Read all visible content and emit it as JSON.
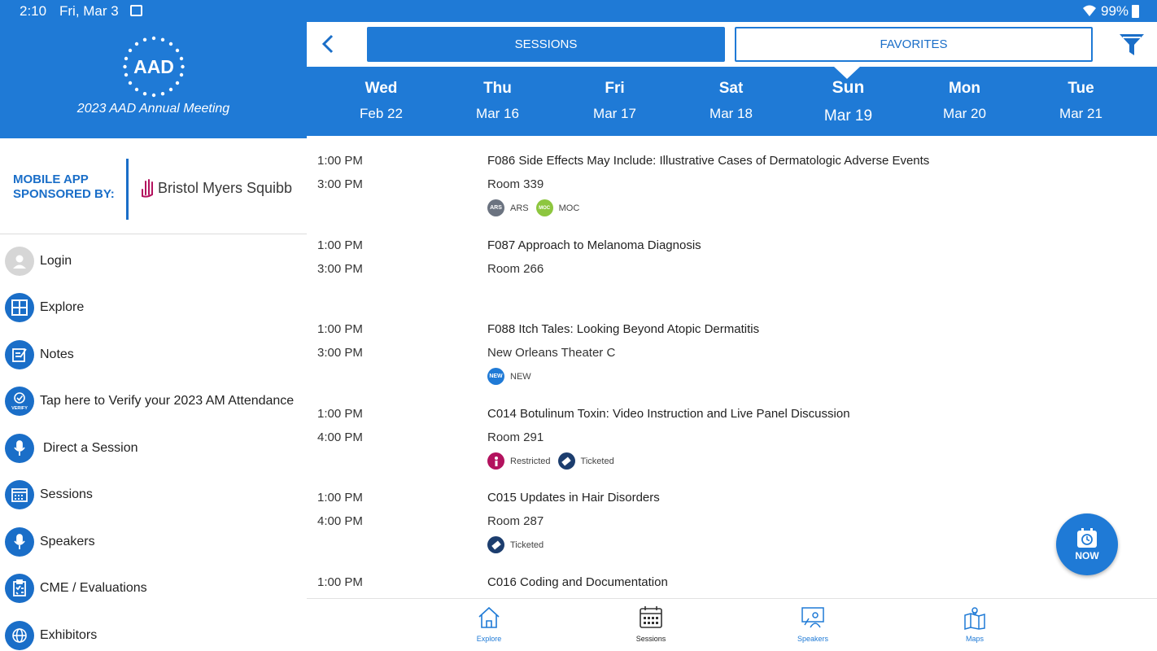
{
  "status_bar": {
    "time": "2:10",
    "date": "Fri, Mar 3",
    "battery": "99%"
  },
  "sidebar": {
    "logo_text": "AAD",
    "meeting_title": "2023 AAD Annual Meeting",
    "sponsor_label": "MOBILE APP SPONSORED BY:",
    "sponsor_name": "Bristol Myers Squibb",
    "menu": [
      {
        "label": "Login",
        "icon": "user-icon"
      },
      {
        "label": "Explore",
        "icon": "grid-icon"
      },
      {
        "label": "Notes",
        "icon": "notes-icon"
      },
      {
        "label": "Tap here to Verify your 2023 AM Attendance",
        "icon": "verify-icon",
        "icon_text": "VERIFY"
      },
      {
        "label": "Direct a Session",
        "icon": "microphone-icon"
      },
      {
        "label": "Sessions",
        "icon": "calendar-icon"
      },
      {
        "label": "Speakers",
        "icon": "microphone-icon"
      },
      {
        "label": "CME / Evaluations",
        "icon": "clipboard-icon"
      },
      {
        "label": "Exhibitors",
        "icon": "globe-icon"
      }
    ]
  },
  "toolbar": {
    "sessions_label": "SESSIONS",
    "favorites_label": "FAVORITES"
  },
  "days": [
    {
      "name": "Wed",
      "date": "Feb 22"
    },
    {
      "name": "Thu",
      "date": "Mar 16"
    },
    {
      "name": "Fri",
      "date": "Mar 17"
    },
    {
      "name": "Sat",
      "date": "Mar 18"
    },
    {
      "name": "Sun",
      "date": "Mar 19",
      "selected": true
    },
    {
      "name": "Mon",
      "date": "Mar 20"
    },
    {
      "name": "Tue",
      "date": "Mar 21"
    }
  ],
  "sessions": [
    {
      "start": "1:00 PM",
      "end": "3:00 PM",
      "title": "F086 Side Effects May Include: Illustrative Cases of Dermatologic Adverse Events",
      "room": "Room 339",
      "badges": [
        {
          "label": "ARS",
          "icon_text": "ARS",
          "color": "#6b7380"
        },
        {
          "label": "MOC",
          "icon_text": "MOC",
          "color": "#8dc63f"
        }
      ]
    },
    {
      "start": "1:00 PM",
      "end": "3:00 PM",
      "title": "F087 Approach to Melanoma Diagnosis",
      "room": "Room 266",
      "badges": []
    },
    {
      "start": "1:00 PM",
      "end": "3:00 PM",
      "title": "F088 Itch Tales: Looking Beyond Atopic Dermatitis",
      "room": "New Orleans Theater C",
      "badges": [
        {
          "label": "NEW",
          "icon_text": "NEW",
          "color": "#1f7ad6"
        }
      ]
    },
    {
      "start": "1:00 PM",
      "end": "4:00 PM",
      "title": "C014 Botulinum Toxin: Video Instruction and Live Panel Discussion",
      "room": "Room 291",
      "badges": [
        {
          "label": "Restricted",
          "icon_text": "",
          "color": "#b3125e"
        },
        {
          "label": "Ticketed",
          "icon_text": "",
          "color": "#1c3d6e"
        }
      ]
    },
    {
      "start": "1:00 PM",
      "end": "4:00 PM",
      "title": "C015 Updates in Hair Disorders",
      "room": "Room 287",
      "badges": [
        {
          "label": "Ticketed",
          "icon_text": "",
          "color": "#1c3d6e"
        }
      ]
    },
    {
      "start": "1:00 PM",
      "end": "",
      "title": "C016 Coding and Documentation",
      "room": "",
      "badges": []
    }
  ],
  "fab": {
    "label": "NOW"
  },
  "bottom_nav": [
    {
      "label": "Explore",
      "icon": "home-icon"
    },
    {
      "label": "Sessions",
      "icon": "calendar-icon",
      "active": true
    },
    {
      "label": "Speakers",
      "icon": "presenter-icon"
    },
    {
      "label": "Maps",
      "icon": "map-icon"
    }
  ],
  "colors": {
    "primary": "#1f7ad6",
    "sponsor_blue": "#1a6ec8",
    "text": "#222222"
  }
}
